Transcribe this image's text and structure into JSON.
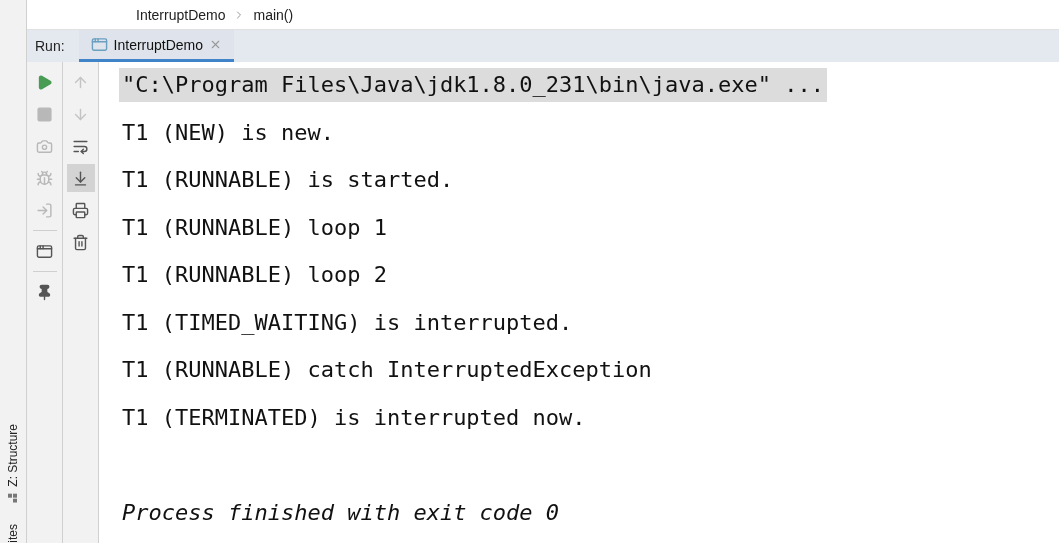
{
  "breadcrumb": [
    "InterruptDemo",
    "main()"
  ],
  "side_tabs": [
    {
      "label": "Z: Structure",
      "kind": "structure"
    },
    {
      "label": "ites",
      "kind": "favorites"
    }
  ],
  "run_bar": {
    "label": "Run:",
    "tabs": [
      {
        "label": "InterruptDemo",
        "selected": true
      }
    ]
  },
  "left_tools": [
    {
      "kind": "play",
      "disabled": false
    },
    {
      "kind": "stop",
      "disabled": true
    },
    {
      "kind": "camera",
      "disabled": true
    },
    {
      "kind": "bug",
      "disabled": true
    },
    {
      "kind": "login",
      "disabled": true
    },
    {
      "kind": "separator"
    },
    {
      "kind": "layout",
      "disabled": false
    },
    {
      "kind": "separator"
    },
    {
      "kind": "pin",
      "disabled": false
    }
  ],
  "right_tools": [
    {
      "kind": "up",
      "disabled": true,
      "selected": false
    },
    {
      "kind": "down",
      "disabled": true,
      "selected": false
    },
    {
      "kind": "wrap",
      "disabled": false,
      "selected": false
    },
    {
      "kind": "scroll-end",
      "disabled": false,
      "selected": true
    },
    {
      "kind": "print",
      "disabled": false,
      "selected": false
    },
    {
      "kind": "trash",
      "disabled": false,
      "selected": false
    }
  ],
  "console": [
    {
      "kind": "command",
      "text": "\"C:\\Program Files\\Java\\jdk1.8.0_231\\bin\\java.exe\" ..."
    },
    {
      "kind": "output",
      "text": "T1 (NEW) is new."
    },
    {
      "kind": "output",
      "text": "T1 (RUNNABLE) is started."
    },
    {
      "kind": "output",
      "text": "T1 (RUNNABLE) loop 1"
    },
    {
      "kind": "output",
      "text": "T1 (RUNNABLE) loop 2"
    },
    {
      "kind": "output",
      "text": "T1 (TIMED_WAITING) is interrupted."
    },
    {
      "kind": "output",
      "text": "T1 (RUNNABLE) catch InterruptedException"
    },
    {
      "kind": "output",
      "text": "T1 (TERMINATED) is interrupted now."
    },
    {
      "kind": "exit",
      "text": "Process finished with exit code 0"
    }
  ]
}
